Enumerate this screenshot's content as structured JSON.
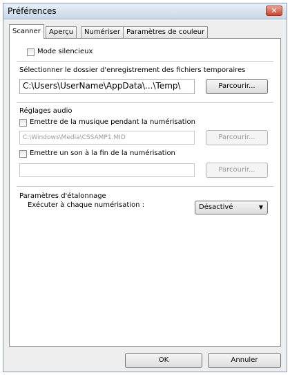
{
  "window": {
    "title": "Préférences",
    "close_glyph": "✕"
  },
  "tabs": [
    {
      "label": "Scanner",
      "active": true
    },
    {
      "label": "Aperçu"
    },
    {
      "label": "Numériser"
    },
    {
      "label": "Paramètres de couleur"
    }
  ],
  "scanner": {
    "silent_mode_label": "Mode silencieux",
    "temp_folder_label": "Sélectionner le dossier d'enregistrement des fichiers temporaires",
    "temp_folder_value": "C:\\Users\\UserName\\AppData\\...\\Temp\\",
    "browse_label": "Parcourir...",
    "audio_section_label": "Réglages audio",
    "play_music_label": "Emettre de la musique pendant la numérisation",
    "music_path_value": "C:\\Windows\\Media\\CSSAMP1.MID",
    "browse_music_label": "Parcourir...",
    "play_sound_end_label": "Emettre un son à la fin de la numérisation",
    "sound_path_value": "",
    "browse_sound_label": "Parcourir...",
    "calibration_section_label": "Paramètres d'étalonnage",
    "calibration_run_label": "Exécuter à chaque numérisation :",
    "calibration_value": "Désactivé"
  },
  "footer": {
    "ok_label": "OK",
    "cancel_label": "Annuler"
  }
}
